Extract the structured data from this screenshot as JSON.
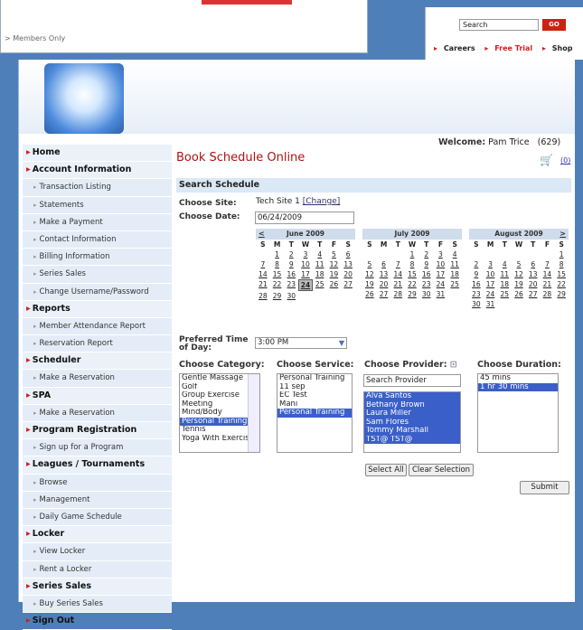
{
  "header": {
    "members_only": "> Members Only",
    "search_value": "Search",
    "go_label": "GO",
    "links": [
      "Careers",
      "Free Trial",
      "Shop"
    ]
  },
  "welcome": {
    "label": "Welcome:",
    "name": "Pam Trice",
    "code": "(629)",
    "cart_count": "(0)"
  },
  "page_title": "Book Schedule Online",
  "sidebar": [
    {
      "type": "head",
      "label": "Home"
    },
    {
      "type": "head",
      "label": "Account Information"
    },
    {
      "type": "sub",
      "label": "Transaction Listing"
    },
    {
      "type": "sub",
      "label": "Statements"
    },
    {
      "type": "sub",
      "label": "Make a Payment"
    },
    {
      "type": "sub",
      "label": "Contact Information"
    },
    {
      "type": "sub",
      "label": "Billing Information"
    },
    {
      "type": "sub",
      "label": "Series Sales"
    },
    {
      "type": "sub",
      "label": "Change Username/Password"
    },
    {
      "type": "head",
      "label": "Reports"
    },
    {
      "type": "sub",
      "label": "Member Attendance Report"
    },
    {
      "type": "sub",
      "label": "Reservation Report"
    },
    {
      "type": "head",
      "label": "Scheduler"
    },
    {
      "type": "sub",
      "label": "Make a Reservation"
    },
    {
      "type": "head",
      "label": "SPA"
    },
    {
      "type": "sub",
      "label": "Make a Reservation"
    },
    {
      "type": "head",
      "label": "Program Registration"
    },
    {
      "type": "sub",
      "label": "Sign up for a Program"
    },
    {
      "type": "head",
      "label": "Leagues / Tournaments"
    },
    {
      "type": "sub",
      "label": "Browse"
    },
    {
      "type": "sub",
      "label": "Management"
    },
    {
      "type": "sub",
      "label": "Daily Game Schedule"
    },
    {
      "type": "head",
      "label": "Locker"
    },
    {
      "type": "sub",
      "label": "View Locker"
    },
    {
      "type": "sub",
      "label": "Rent a Locker"
    },
    {
      "type": "head",
      "label": "Series Sales"
    },
    {
      "type": "sub",
      "label": "Buy Series Sales"
    },
    {
      "type": "head",
      "label": "Sign Out"
    }
  ],
  "form": {
    "section_title": "Search Schedule",
    "site_label": "Choose Site:",
    "site_value": "Tech Site 1",
    "site_change": "[Change]",
    "date_label": "Choose Date:",
    "date_value": "06/24/2009",
    "pref_label": "Preferred Time of Day:",
    "pref_value": "3:00 PM",
    "category_label": "Choose Category:",
    "service_label": "Choose Service:",
    "provider_label": "Choose Provider:",
    "duration_label": "Choose Duration:",
    "provider_search": "Search Provider",
    "select_all": "Select All",
    "clear_selection": "Clear Selection",
    "submit": "Submit"
  },
  "categories": [
    {
      "label": "Gentle Massage",
      "selected": false
    },
    {
      "label": "Golf",
      "selected": false
    },
    {
      "label": "Group Exercise",
      "selected": false
    },
    {
      "label": "Meeting",
      "selected": false
    },
    {
      "label": "Mind/Body",
      "selected": false
    },
    {
      "label": "Personal Training",
      "selected": true
    },
    {
      "label": "Tennis",
      "selected": false
    },
    {
      "label": "Yoga With Exercise",
      "selected": false
    }
  ],
  "services": [
    {
      "label": "Personal Training",
      "selected": false
    },
    {
      "label": "11 sep",
      "selected": false
    },
    {
      "label": "EC Test",
      "selected": false
    },
    {
      "label": "Mani",
      "selected": false
    },
    {
      "label": "Personal Training",
      "selected": true
    }
  ],
  "providers": [
    {
      "label": "Alva Santos",
      "selected": true
    },
    {
      "label": "Bethany Brown",
      "selected": true
    },
    {
      "label": "Laura Miller",
      "selected": true
    },
    {
      "label": "Sam Flores",
      "selected": true
    },
    {
      "label": "Tommy Marshall",
      "selected": true
    },
    {
      "label": "TST@ TST@",
      "selected": true
    }
  ],
  "durations": [
    {
      "label": "45 mins",
      "selected": false
    },
    {
      "label": "1 hr 30 mins",
      "selected": true
    }
  ],
  "calendars": [
    {
      "title": "June 2009",
      "prev": "<",
      "next": "",
      "dow": [
        "S",
        "M",
        "T",
        "W",
        "T",
        "F",
        "S"
      ],
      "weeks": [
        [
          "",
          "1",
          "2",
          "3",
          "4",
          "5",
          "6"
        ],
        [
          "7",
          "8",
          "9",
          "10",
          "11",
          "12",
          "13"
        ],
        [
          "14",
          "15",
          "16",
          "17",
          "18",
          "19",
          "20"
        ],
        [
          "21",
          "22",
          "23",
          "24",
          "25",
          "26",
          "27"
        ],
        [
          "28",
          "29",
          "30",
          "",
          "",
          "",
          ""
        ]
      ],
      "selected": "24"
    },
    {
      "title": "July 2009",
      "prev": "",
      "next": "",
      "dow": [
        "S",
        "M",
        "T",
        "W",
        "T",
        "F",
        "S"
      ],
      "weeks": [
        [
          "",
          "",
          "",
          "1",
          "2",
          "3",
          "4"
        ],
        [
          "5",
          "6",
          "7",
          "8",
          "9",
          "10",
          "11"
        ],
        [
          "12",
          "13",
          "14",
          "15",
          "16",
          "17",
          "18"
        ],
        [
          "19",
          "20",
          "21",
          "22",
          "23",
          "24",
          "25"
        ],
        [
          "26",
          "27",
          "28",
          "29",
          "30",
          "31",
          ""
        ]
      ],
      "selected": ""
    },
    {
      "title": "August 2009",
      "prev": "",
      "next": ">",
      "dow": [
        "S",
        "M",
        "T",
        "W",
        "T",
        "F",
        "S"
      ],
      "weeks": [
        [
          "",
          "",
          "",
          "",
          "",
          "",
          "1"
        ],
        [
          "2",
          "3",
          "4",
          "5",
          "6",
          "7",
          "8"
        ],
        [
          "9",
          "10",
          "11",
          "12",
          "13",
          "14",
          "15"
        ],
        [
          "16",
          "17",
          "18",
          "19",
          "20",
          "21",
          "22"
        ],
        [
          "23",
          "24",
          "25",
          "26",
          "27",
          "28",
          "29"
        ],
        [
          "30",
          "31",
          "",
          "",
          "",
          "",
          ""
        ]
      ],
      "selected": ""
    }
  ]
}
